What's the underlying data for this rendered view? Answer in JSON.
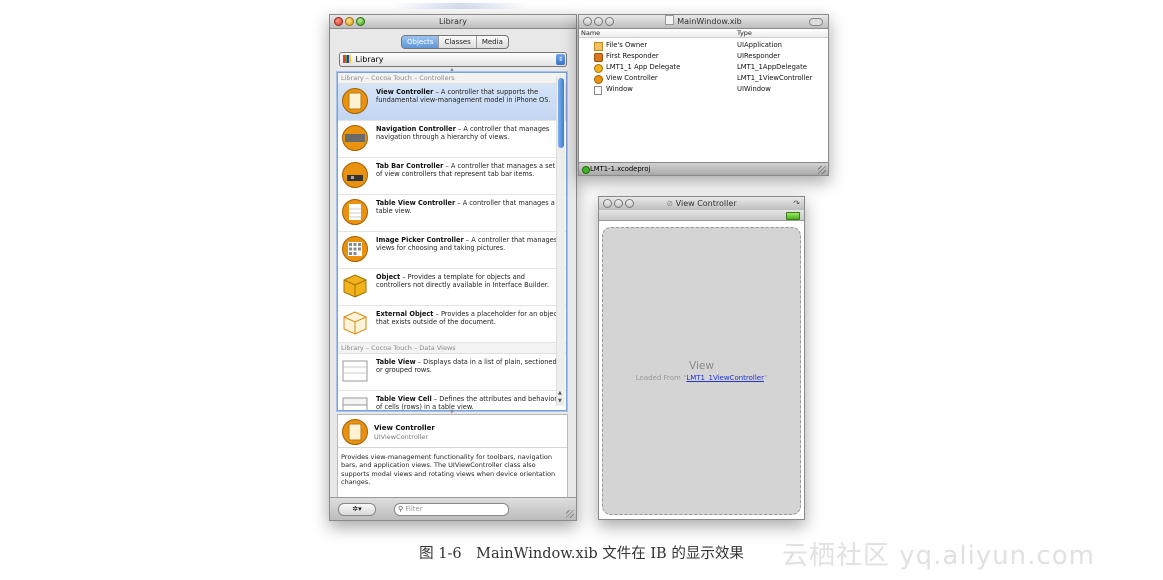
{
  "library": {
    "title": "Library",
    "segments": [
      "Objects",
      "Classes",
      "Media"
    ],
    "popup_label": "Library",
    "sections": [
      {
        "label": "Library – Cocoa Touch – Controllers"
      },
      {
        "label": "Library – Cocoa Touch – Data Views"
      }
    ],
    "items": [
      {
        "name": "View Controller",
        "desc": " – A controller that supports the fundamental view-management model in iPhone OS."
      },
      {
        "name": "Navigation Controller",
        "desc": " – A controller that manages navigation through a hierarchy of views."
      },
      {
        "name": "Tab Bar Controller",
        "desc": " – A controller that manages a set of view controllers that represent tab bar items."
      },
      {
        "name": "Table View Controller",
        "desc": " – A controller that manages a table view."
      },
      {
        "name": "Image Picker Controller",
        "desc": " – A controller that manages views for choosing and taking pictures."
      },
      {
        "name": "Object",
        "desc": " – Provides a template for objects and controllers not directly available in Interface Builder."
      },
      {
        "name": "External Object",
        "desc": " – Provides a placeholder for an object that exists outside of the document."
      },
      {
        "name": "Table View",
        "desc": " – Displays data in a list of plain, sectioned, or grouped rows."
      },
      {
        "name": "Table View Cell",
        "desc": " – Defines the attributes and behavior of cells (rows) in a table view."
      }
    ],
    "detail": {
      "name": "View Controller",
      "class": "UIViewController",
      "text": "Provides view-management functionality for toolbars, navigation bars, and application views. The UIViewController class also supports modal views and rotating views when device orientation changes."
    },
    "filter_placeholder": "Filter"
  },
  "xib": {
    "title": "MainWindow.xib",
    "col_name": "Name",
    "col_type": "Type",
    "rows": [
      {
        "name": "File's Owner",
        "type": "UIApplication"
      },
      {
        "name": "First Responder",
        "type": "UIResponder"
      },
      {
        "name": "LMT1_1 App Delegate",
        "type": "LMT1_1AppDelegate"
      },
      {
        "name": "View Controller",
        "type": "LMT1_1ViewController"
      },
      {
        "name": "Window",
        "type": "UIWindow"
      }
    ],
    "project": "LMT1-1.xcodeproj"
  },
  "vc": {
    "title": "View Controller",
    "view_label": "View",
    "loaded_prefix": "Loaded From \"",
    "loaded_link": "LMT1_1ViewController",
    "loaded_suffix": "\""
  },
  "caption": "图 1-6　MainWindow.xib 文件在 IB 的显示效果",
  "watermark": "云栖社区 yq.aliyun.com"
}
